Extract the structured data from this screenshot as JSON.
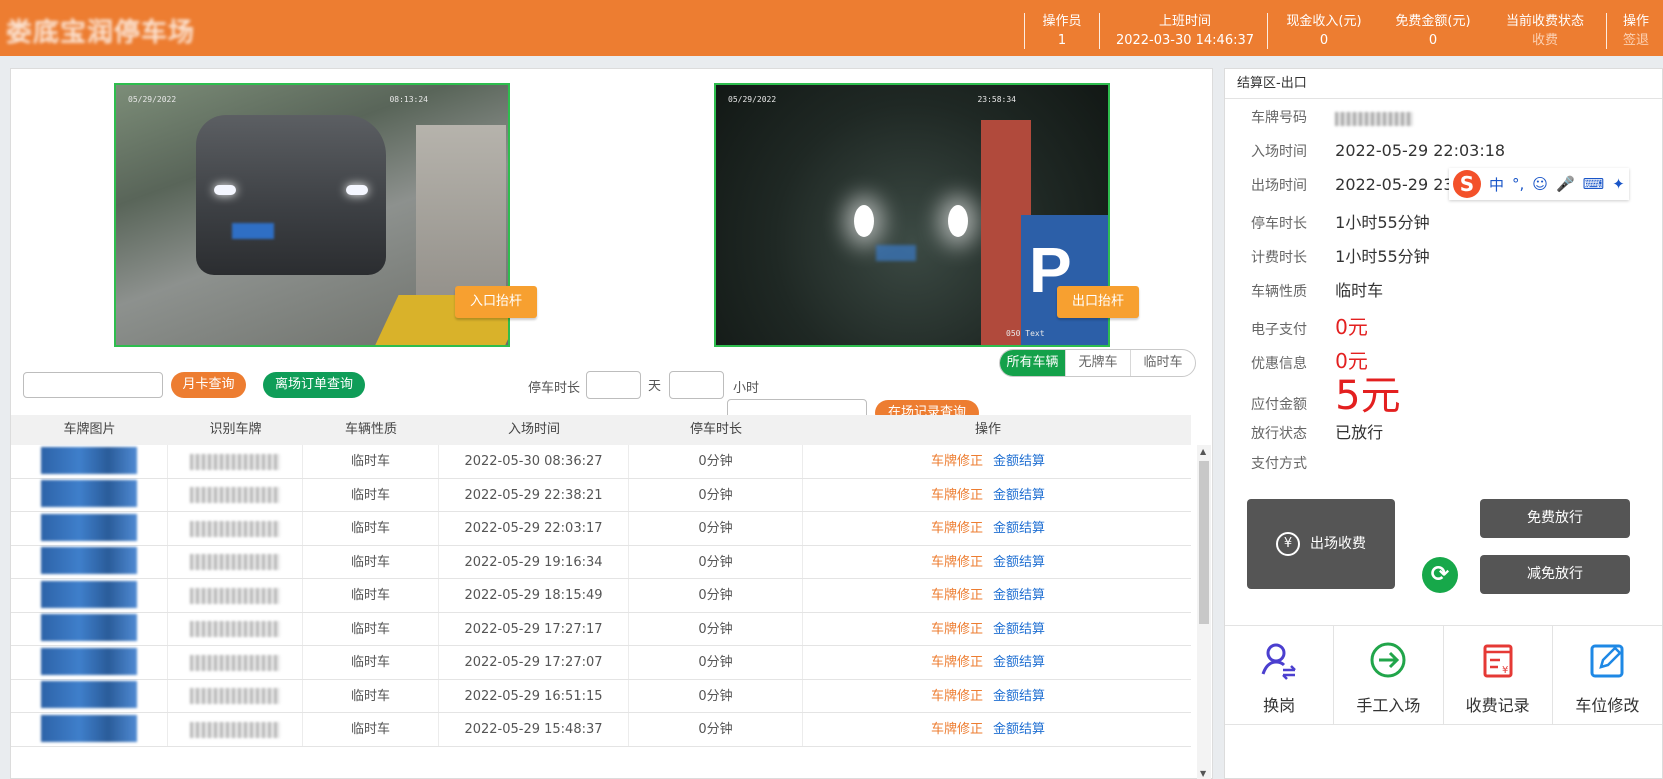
{
  "header": {
    "title": "娄底宝润停车场",
    "operator_label": "操作员",
    "operator_value": "1",
    "shift_label": "上班时间",
    "shift_value": "2022-03-30 14:46:37",
    "cash_label": "现金收入(元)",
    "cash_value": "0",
    "free_label": "免费金额(元)",
    "free_value": "0",
    "status_label": "当前收费状态",
    "status_value": "收费",
    "ops_label": "操作",
    "ops_value": "签退"
  },
  "cameras": {
    "entry": {
      "timestamp": "05/29/2022",
      "time": "08:13:24",
      "lift_label": "入口抬杆"
    },
    "exit": {
      "timestamp": "05/29/2022",
      "time": "23:58:34",
      "lift_label": "出口抬杆",
      "caption": "050 Text"
    }
  },
  "filters": {
    "month_card_button": "月卡查询",
    "leave_order_button": "离场订单查询",
    "park_duration_label": "停车时长",
    "day_unit": "天",
    "hour_unit": "小时",
    "record_query_button": "在场记录查询",
    "segments": [
      "所有车辆",
      "无牌车",
      "临时车"
    ]
  },
  "table": {
    "columns": [
      "车牌图片",
      "识别车牌",
      "车辆性质",
      "入场时间",
      "停车时长",
      "操作"
    ],
    "fix_action": "车牌修正",
    "pay_action": "金额结算",
    "rows": [
      {
        "type": "临时车",
        "entry": "2022-05-30 08:36:27",
        "duration": "0分钟"
      },
      {
        "type": "临时车",
        "entry": "2022-05-29 22:38:21",
        "duration": "0分钟"
      },
      {
        "type": "临时车",
        "entry": "2022-05-29 22:03:17",
        "duration": "0分钟"
      },
      {
        "type": "临时车",
        "entry": "2022-05-29 19:16:34",
        "duration": "0分钟"
      },
      {
        "type": "临时车",
        "entry": "2022-05-29 18:15:49",
        "duration": "0分钟"
      },
      {
        "type": "临时车",
        "entry": "2022-05-29 17:27:17",
        "duration": "0分钟"
      },
      {
        "type": "临时车",
        "entry": "2022-05-29 17:27:07",
        "duration": "0分钟"
      },
      {
        "type": "临时车",
        "entry": "2022-05-29 16:51:15",
        "duration": "0分钟"
      },
      {
        "type": "临时车",
        "entry": "2022-05-29 15:48:37",
        "duration": "0分钟"
      }
    ]
  },
  "settlement": {
    "section_title": "结算区-出口",
    "plate_label": "车牌号码",
    "entry_label": "入场时间",
    "entry_value": "2022-05-29 22:03:18",
    "exit_label": "出场时间",
    "exit_value": "2022-05-29 23",
    "park_label": "停车时长",
    "park_value": "1小时55分钟",
    "bill_label": "计费时长",
    "bill_value": "1小时55分钟",
    "type_label": "车辆性质",
    "type_value": "临时车",
    "epay_label": "电子支付",
    "epay_value": "0元",
    "discount_label": "优惠信息",
    "discount_value": "0元",
    "due_label": "应付金额",
    "due_value": "5元",
    "release_label": "放行状态",
    "release_value": "已放行",
    "paymethod_label": "支付方式",
    "charge_button": "出场收费",
    "free_release_button": "免费放行",
    "reduced_release_button": "减免放行"
  },
  "ime": {
    "logo": "S",
    "mode": "中"
  },
  "tools": [
    {
      "label": "换岗",
      "icon": "user-switch-icon",
      "color": "#4b3fcf"
    },
    {
      "label": "手工入场",
      "icon": "arrow-enter-icon",
      "color": "#21a54a"
    },
    {
      "label": "收费记录",
      "icon": "receipt-icon",
      "color": "#e53935"
    },
    {
      "label": "车位修改",
      "icon": "edit-icon",
      "color": "#1e88e5"
    }
  ]
}
